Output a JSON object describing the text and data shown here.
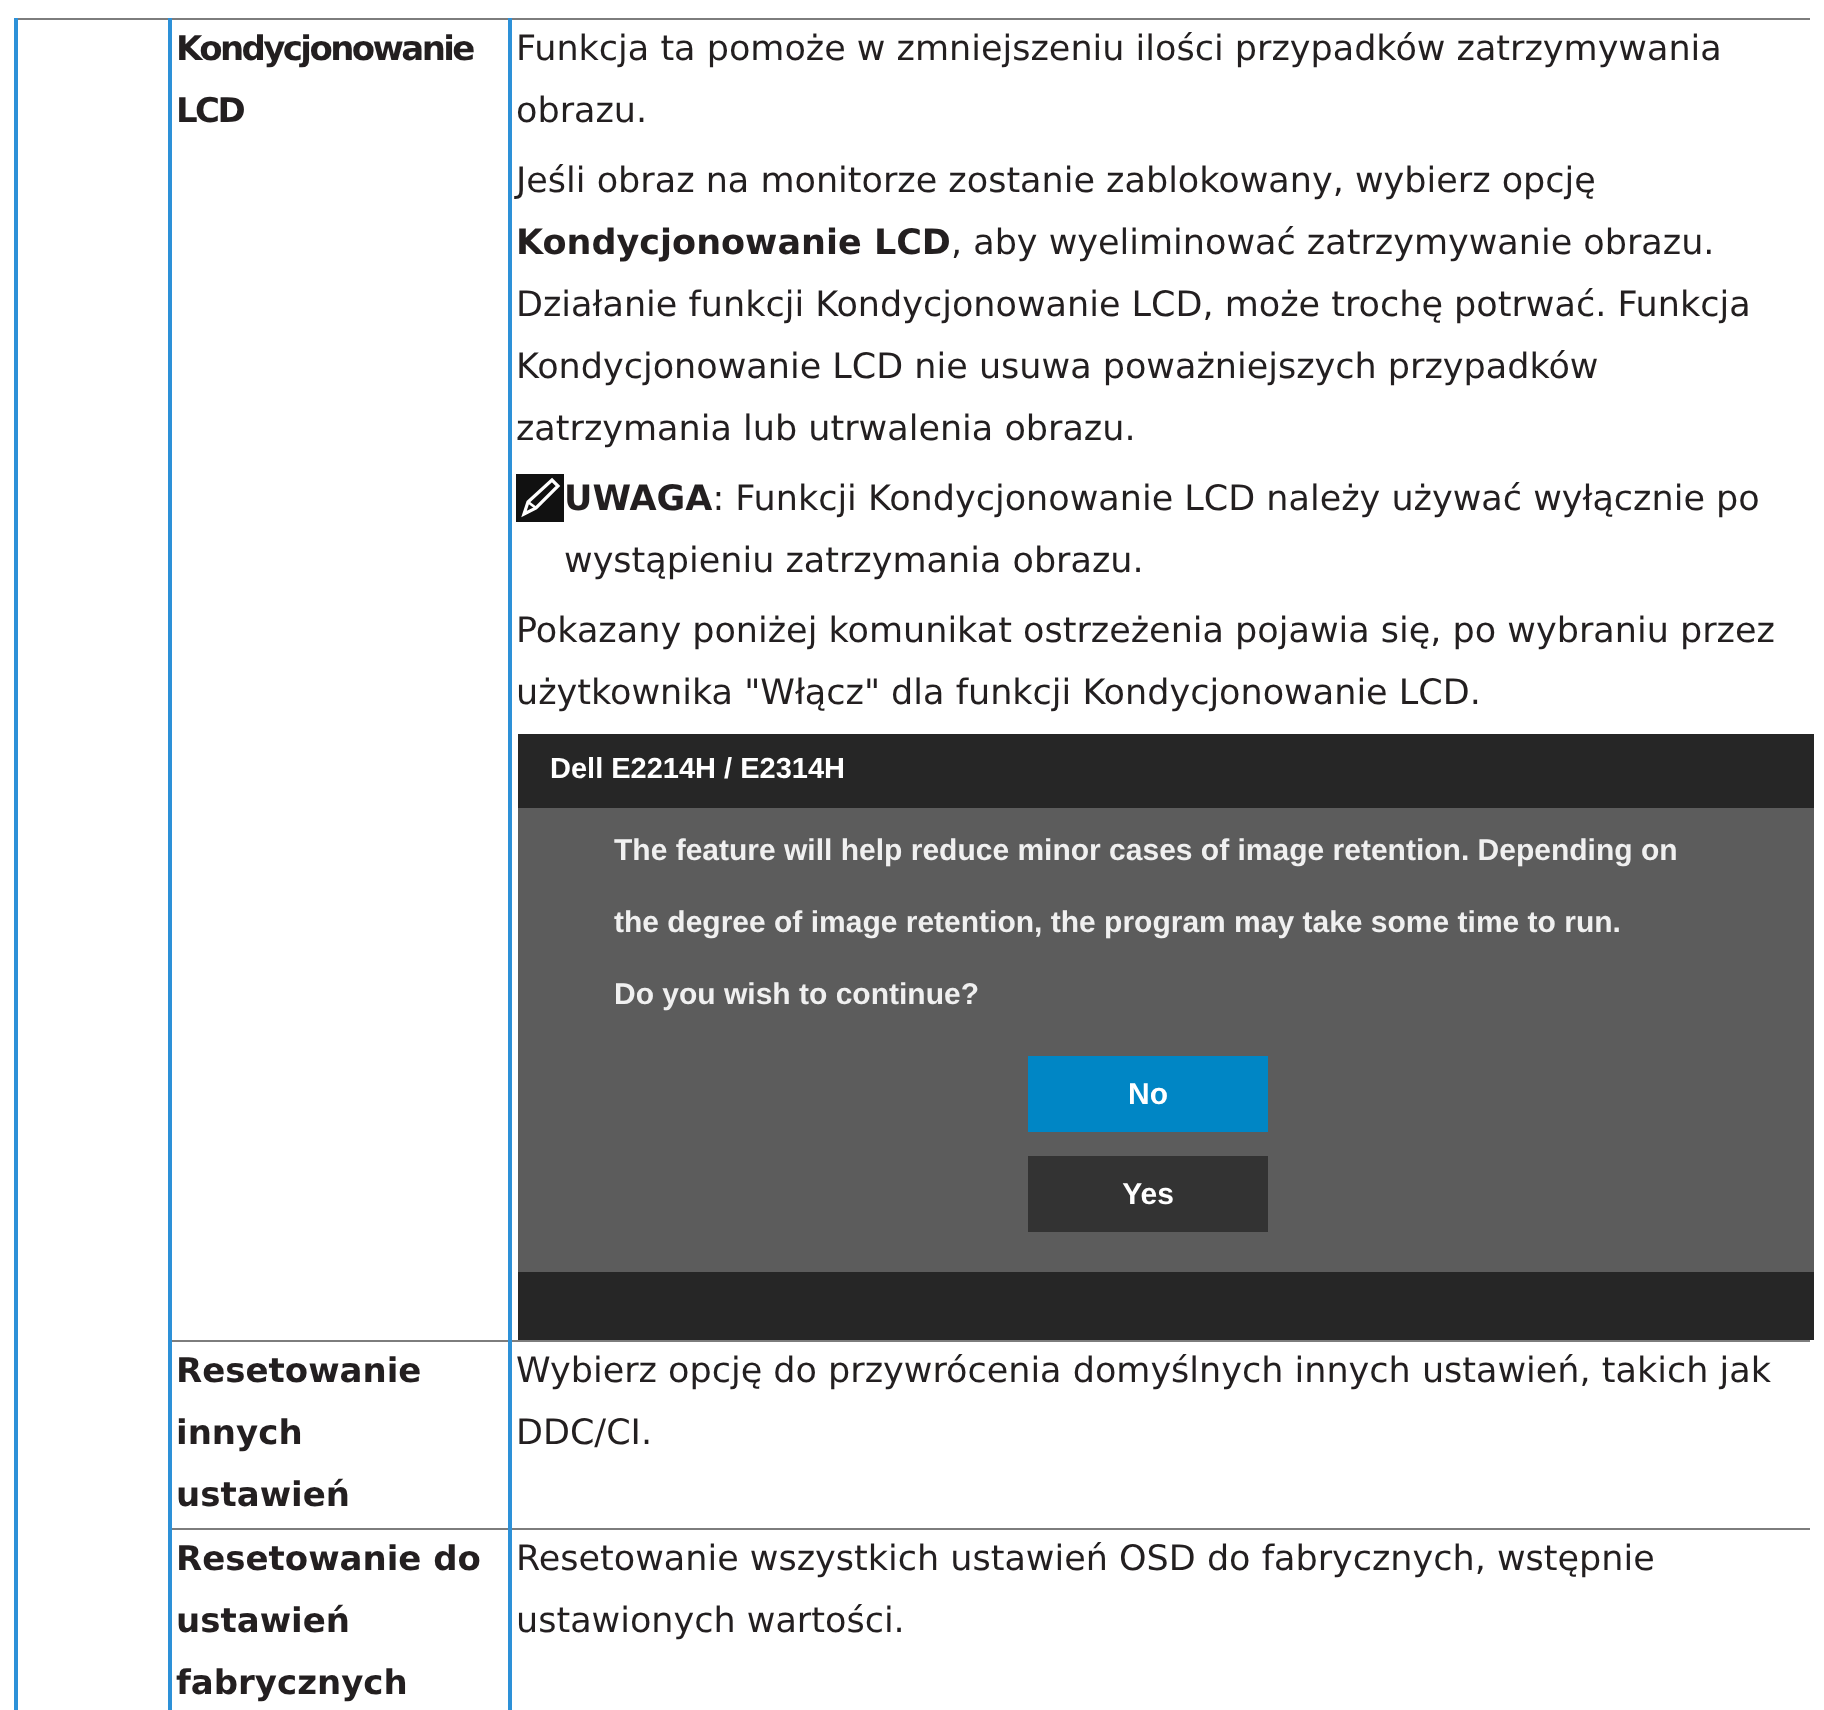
{
  "rows": [
    {
      "label": "Kondycjonowanie LCD",
      "content": [
        {
          "kind": "text",
          "text": "Funkcja ta pomoże w zmniejszeniu ilości przypadków zatrzymywania obrazu."
        },
        {
          "kind": "text",
          "text": "Jeśli obraz na monitorze zostanie zablokowany, wybierz opcję **Kondycjonowanie LCD**, aby wyeliminować zatrzymywanie obrazu. Działanie funkcji Kondycjonowanie LCD, może trochę potrwać. Funkcja Kondycjonowanie LCD nie usuwa poważniejszych przypadków zatrzymania lub utrwalenia obrazu."
        },
        {
          "kind": "note",
          "text": "**UWAGA**: Funkcji Kondycjonowanie LCD należy używać wyłącznie po wystąpieniu zatrzymania obrazu."
        },
        {
          "kind": "text",
          "text": "Pokazany poniżej komunikat ostrzeżenia pojawia się, po wybraniu przez użytkownika \"Włącz\" dla funkcji Kondycjonowanie LCD."
        },
        {
          "kind": "dialog",
          "title": "Dell E2214H / E2314H",
          "lines": [
            "The feature will help reduce minor cases of image retention. Depending on",
            "the degree of image retention, the program may take some time to run.",
            "Do you wish to continue?"
          ],
          "buttons": [
            {
              "label": "No",
              "selected": true
            },
            {
              "label": "Yes",
              "selected": false
            }
          ]
        }
      ]
    },
    {
      "label": "Resetowanie innych ustawień",
      "content": [
        {
          "kind": "text",
          "text": "Wybierz opcję do przywrócenia domyślnych innych ustawień, takich jak DDC/CI."
        }
      ]
    },
    {
      "label": "Resetowanie do ustawień fabrycznych",
      "content": [
        {
          "kind": "text",
          "text": "Resetowanie wszystkich ustawień OSD do fabrycznych, wstępnie ustawionych wartości."
        }
      ]
    }
  ]
}
